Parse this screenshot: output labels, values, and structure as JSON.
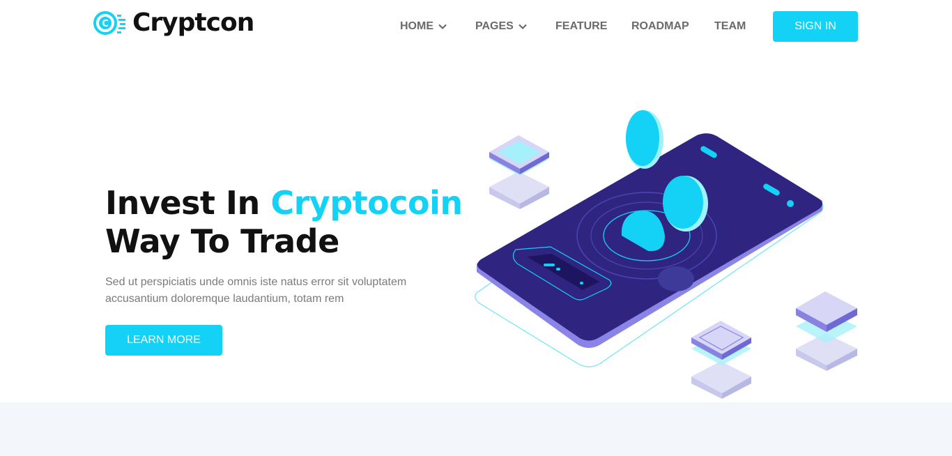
{
  "brand": {
    "name": "Cryptcon",
    "logo_icon": "coin-speed-icon"
  },
  "nav": {
    "items": [
      {
        "label": "HOME",
        "has_dropdown": true
      },
      {
        "label": "PAGES",
        "has_dropdown": true
      },
      {
        "label": "FEATURE",
        "has_dropdown": false
      },
      {
        "label": "ROADMAP",
        "has_dropdown": false
      },
      {
        "label": "TEAM",
        "has_dropdown": false
      }
    ],
    "signin_label": "SIGN IN"
  },
  "hero": {
    "title_part1": "Invest In ",
    "title_accent": "Cryptocoin",
    "title_line2": "Way To Trade",
    "description": "Sed ut perspiciatis unde omnis iste natus error sit voluptatem accusantium doloremque laudantium, totam rem",
    "cta_label": "LEARN MORE",
    "illustration_icon": "isometric-phone-coins-icon"
  },
  "colors": {
    "accent": "#14d2f5",
    "phone": "#2f2580",
    "text_dark": "#111111",
    "text_muted": "#7a7a7a",
    "band": "#f3f7fc"
  }
}
